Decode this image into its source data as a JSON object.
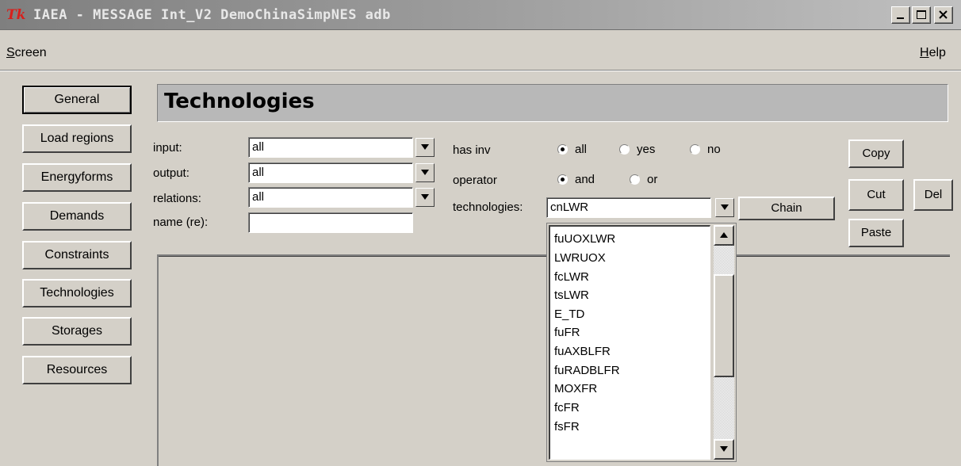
{
  "window": {
    "title": "IAEA - MESSAGE Int_V2 DemoChinaSimpNES adb",
    "logo": "tk-feather-logo",
    "controls": [
      "minimize-icon",
      "maximize-icon",
      "close-icon"
    ]
  },
  "menubar": {
    "screen_mnemonic": "S",
    "screen_rest": "creen",
    "help_mnemonic": "H",
    "help_rest": "elp"
  },
  "nav": {
    "active": "General",
    "items": [
      {
        "label": "General"
      },
      {
        "label": "Load regions"
      },
      {
        "label": "Energyforms"
      },
      {
        "label": "Demands"
      },
      {
        "label": "Constraints"
      },
      {
        "label": "Technologies"
      },
      {
        "label": "Storages"
      },
      {
        "label": "Resources"
      }
    ]
  },
  "header": {
    "title": "Technologies"
  },
  "filters": {
    "input": {
      "label": "input:",
      "value": "all"
    },
    "output": {
      "label": "output:",
      "value": "all"
    },
    "relations": {
      "label": "relations:",
      "value": "all"
    },
    "name": {
      "label": "name (re):",
      "value": ""
    }
  },
  "options": {
    "has_inv": {
      "label": "has inv",
      "selected": "all",
      "choices": [
        "all",
        "yes",
        "no"
      ]
    },
    "operator": {
      "label": "operator",
      "selected": "and",
      "choices": [
        "and",
        "or"
      ]
    },
    "technologies": {
      "label": "technologies:",
      "value": "cnLWR"
    }
  },
  "buttons": {
    "chain": "Chain",
    "copy": "Copy",
    "cut": "Cut",
    "del": "Del",
    "paste": "Paste"
  },
  "technology_list": {
    "items": [
      "fuUOXLWR",
      "LWRUOX",
      "fcLWR",
      "tsLWR",
      "E_TD",
      "fuFR",
      "fuAXBLFR",
      "fuRADBLFR",
      "MOXFR",
      "fcFR",
      "fsFR"
    ]
  },
  "colors": {
    "face": "#d4d0c8",
    "header_panel": "#b8b8b8",
    "titlebar": "#8c8c8c"
  }
}
